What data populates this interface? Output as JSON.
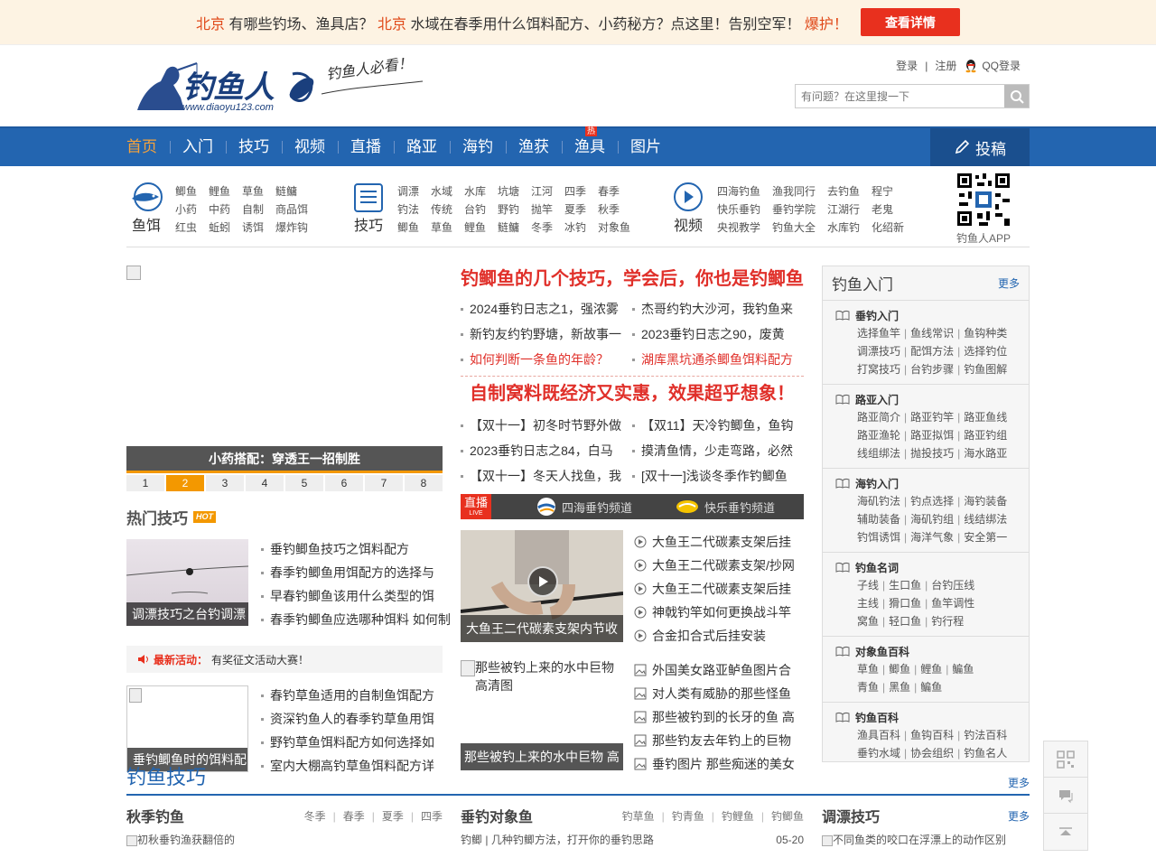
{
  "topbar": {
    "city": "北京",
    "text1": "有哪些钓场、渔具店？",
    "text2": "水域在春季用什么饵料配方、小药秘方？点这里！告别空军！",
    "hot": "爆护！",
    "button": "查看详情"
  },
  "header": {
    "logo_text": "钓鱼人",
    "logo_url": "www.diaoyu123.com",
    "slogan": "钓鱼人必看！",
    "login": "登录",
    "register": "注册",
    "qq_login": "QQ登录",
    "search_placeholder": "有问题？在这里搜一下"
  },
  "nav": {
    "items": [
      "首页",
      "入门",
      "技巧",
      "视频",
      "直播",
      "路亚",
      "海钓",
      "渔获",
      "渔具",
      "图片"
    ],
    "hot_badge": "热",
    "post": "投稿"
  },
  "subnav": {
    "bait": {
      "label": "鱼饵",
      "links": [
        "鲫鱼",
        "鲤鱼",
        "草鱼",
        "鲢鳙",
        "小药",
        "中药",
        "自制",
        "商品饵",
        "红虫",
        "蚯蚓",
        "诱饵",
        "爆炸钩"
      ]
    },
    "skill": {
      "label": "技巧",
      "links": [
        "调漂",
        "水域",
        "水库",
        "坑塘",
        "江河",
        "四季",
        "春季",
        "钓法",
        "传统",
        "台钓",
        "野钓",
        "抛竿",
        "夏季",
        "秋季",
        "鲫鱼",
        "草鱼",
        "鲤鱼",
        "鲢鳙",
        "冬季",
        "冰钓",
        "对象鱼"
      ]
    },
    "video": {
      "label": "视频",
      "links": [
        "四海钓鱼",
        "渔我同行",
        "去钓鱼",
        "程宁",
        "快乐垂钓",
        "垂钓学院",
        "江湖行",
        "老鬼",
        "央视教学",
        "钓鱼大全",
        "水库钓",
        "化绍新"
      ]
    },
    "app": "钓鱼人APP"
  },
  "slider": {
    "caption": "小药搭配：穿透王一招制胜",
    "pages": [
      "1",
      "2",
      "3",
      "4",
      "5",
      "6",
      "7",
      "8"
    ],
    "active": 1
  },
  "hot_skills": {
    "title": "热门技巧",
    "badge": "HOT",
    "thumb1_caption": "调漂技巧之台钓调漂",
    "list1": [
      "垂钓鲫鱼技巧之饵料配方",
      "春季钓鲫鱼用饵配方的选择与",
      "早春钓鲫鱼该用什么类型的饵",
      "春季钓鲫鱼应选哪种饵料 如何制"
    ],
    "activity_label": "最新活动：",
    "activity_text": "有奖征文活动大赛！",
    "thumb2_caption": "垂钓鲫鱼时的饵料配",
    "list2": [
      "春钓草鱼适用的自制鱼饵配方",
      "资深钓鱼人的春季钓草鱼用饵",
      "野钓草鱼饵料配方如何选择如",
      "室内大棚高钓草鱼饵料配方详"
    ]
  },
  "news": {
    "headline1": "钓鲫鱼的几个技巧，学会后，你也是钓鲫鱼",
    "group1": [
      "2024垂钓日志之1，强浓雾",
      "杰哥约钓大沙河，我钓鱼来",
      "新钓友约钓野塘，新故事一",
      "2023垂钓日志之90，废黄",
      "如何判断一条鱼的年龄？",
      "湖库黑坑通杀鲫鱼饵料配方"
    ],
    "headline2": "自制窝料既经济又实惠，效果超乎想象！",
    "group2": [
      "【双十一】初冬时节野外做",
      "【双11】天冷钓鲫鱼，鱼钩",
      "2023垂钓日志之84，白马",
      "摸清鱼情，少走弯路，必然",
      "【双十一】冬天人找鱼，我",
      "[双十一]浅谈冬季作钓鲫鱼"
    ]
  },
  "live": {
    "tag": "直播",
    "tag_small": "LIVE",
    "channel1": "四海垂钓频道",
    "channel2": "快乐垂钓频道"
  },
  "videos": {
    "thumb_caption": "大鱼王二代碳素支架内节收",
    "list": [
      "大鱼王二代碳素支架后挂",
      "大鱼王二代碳素支架/抄网",
      "大鱼王二代碳素支架后挂",
      "神戟钓竿如何更换战斗竿",
      "合金扣合式后挂安装"
    ]
  },
  "pictures": {
    "thumb_alt": "那些被钓上来的水中巨物高清图",
    "thumb_caption": "那些被钓上来的水中巨物 高",
    "list": [
      "外国美女路亚鲈鱼图片合",
      "对人类有威胁的那些怪鱼",
      "那些被钓到的长牙的鱼 高",
      "那些钓友去年钓上的巨物",
      "垂钓图片 那些痴迷的美女"
    ]
  },
  "sidebar": {
    "title": "钓鱼入门",
    "more": "更多",
    "groups": [
      {
        "title": "垂钓入门",
        "rows": [
          [
            "选择鱼竿",
            "鱼线常识",
            "鱼钩种类"
          ],
          [
            "调漂技巧",
            "配饵方法",
            "选择钓位"
          ],
          [
            "打窝技巧",
            "台钓步骤",
            "钓鱼图解"
          ]
        ]
      },
      {
        "title": "路亚入门",
        "rows": [
          [
            "路亚简介",
            "路亚钓竿",
            "路亚鱼线"
          ],
          [
            "路亚渔轮",
            "路亚拟饵",
            "路亚钓组"
          ],
          [
            "线组绑法",
            "抛投技巧",
            "海水路亚"
          ]
        ]
      },
      {
        "title": "海钓入门",
        "rows": [
          [
            "海矶钓法",
            "钓点选择",
            "海钓装备"
          ],
          [
            "辅助装备",
            "海矶钓组",
            "线结绑法"
          ],
          [
            "钓饵诱饵",
            "海洋气象",
            "安全第一"
          ]
        ]
      },
      {
        "title": "钓鱼名词",
        "rows": [
          [
            "子线",
            "生口鱼",
            "台钓压线"
          ],
          [
            "主线",
            "猾口鱼",
            "鱼竿调性"
          ],
          [
            "窝鱼",
            "轻口鱼",
            "钓行程"
          ]
        ]
      },
      {
        "title": "对象鱼百科",
        "rows": [
          [
            "草鱼",
            "鲫鱼",
            "鲤鱼",
            "鳊鱼"
          ],
          [
            "青鱼",
            "黑鱼",
            "鳊鱼"
          ]
        ]
      },
      {
        "title": "钓鱼百科",
        "rows": [
          [
            "渔具百科",
            "鱼钩百科",
            "钓法百科"
          ],
          [
            "垂钓水域",
            "协会组织",
            "钓鱼名人"
          ]
        ]
      }
    ]
  },
  "bottom": {
    "title": "钓鱼技巧",
    "more": "更多",
    "col1": {
      "title": "秋季钓鱼",
      "tabs": [
        "冬季",
        "春季",
        "夏季",
        "四季"
      ],
      "item": "初秋垂钓渔获翻倍的"
    },
    "col2": {
      "title": "垂钓对象鱼",
      "tabs": [
        "钓草鱼",
        "钓青鱼",
        "钓鲤鱼",
        "钓鲫鱼"
      ],
      "item_tag": "钓鲫",
      "item": "几种钓鲫方法，打开你的垂钓思路",
      "date": "05-20"
    },
    "col3": {
      "title": "调漂技巧",
      "more": "更多",
      "item": "不同鱼类的咬口在浮漂上的动作区别"
    }
  },
  "colors": {
    "nav_blue": "#2365b0",
    "accent_orange": "#f39800",
    "red": "#e0302a"
  }
}
